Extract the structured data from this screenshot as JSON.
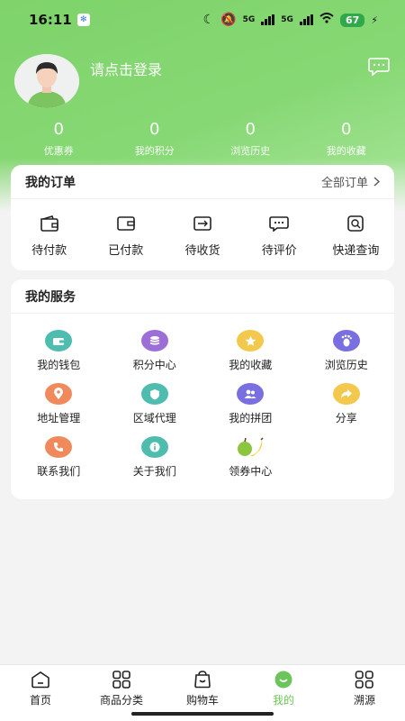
{
  "status_bar": {
    "time": "16:11",
    "network": "5G",
    "battery": "67"
  },
  "profile": {
    "login_prompt": "请点击登录"
  },
  "stats": [
    {
      "value": "0",
      "label": "优惠券"
    },
    {
      "value": "0",
      "label": "我的积分"
    },
    {
      "value": "0",
      "label": "浏览历史"
    },
    {
      "value": "0",
      "label": "我的收藏"
    }
  ],
  "orders": {
    "title": "我的订单",
    "all_link": "全部订单",
    "items": [
      {
        "label": "待付款",
        "icon": "wallet-icon"
      },
      {
        "label": "已付款",
        "icon": "card-icon"
      },
      {
        "label": "待收货",
        "icon": "box-icon"
      },
      {
        "label": "待评价",
        "icon": "comment-icon"
      },
      {
        "label": "快递查询",
        "icon": "search-package-icon"
      }
    ]
  },
  "services": {
    "title": "我的服务",
    "items": [
      {
        "label": "我的钱包",
        "icon": "wallet-icon",
        "color": "#4fbcb0"
      },
      {
        "label": "积分中心",
        "icon": "coins-icon",
        "color": "#9b6fd6"
      },
      {
        "label": "我的收藏",
        "icon": "star-icon",
        "color": "#f2c94c"
      },
      {
        "label": "浏览历史",
        "icon": "footprint-icon",
        "color": "#7a6fe0"
      },
      {
        "label": "地址管理",
        "icon": "location-icon",
        "color": "#f08a5d"
      },
      {
        "label": "区域代理",
        "icon": "shield-icon",
        "color": "#4fbcb0"
      },
      {
        "label": "我的拼团",
        "icon": "group-icon",
        "color": "#7a6fe0"
      },
      {
        "label": "分享",
        "icon": "share-icon",
        "color": "#f2c94c"
      },
      {
        "label": "联系我们",
        "icon": "phone-icon",
        "color": "#f08a5d"
      },
      {
        "label": "关于我们",
        "icon": "info-icon",
        "color": "#4fbcb0"
      },
      {
        "label": "领券中心",
        "icon": "fruit-icon",
        "color": "#f2c94c"
      }
    ]
  },
  "tabbar": [
    {
      "label": "首页",
      "icon": "home-icon",
      "active": false
    },
    {
      "label": "商品分类",
      "icon": "grid-icon",
      "active": false
    },
    {
      "label": "购物车",
      "icon": "cart-icon",
      "active": false
    },
    {
      "label": "我的",
      "icon": "smile-icon",
      "active": true
    },
    {
      "label": "溯源",
      "icon": "trace-icon",
      "active": false
    }
  ],
  "colors": {
    "brand": "#7fd36a",
    "active_tab": "#6cc55a"
  }
}
